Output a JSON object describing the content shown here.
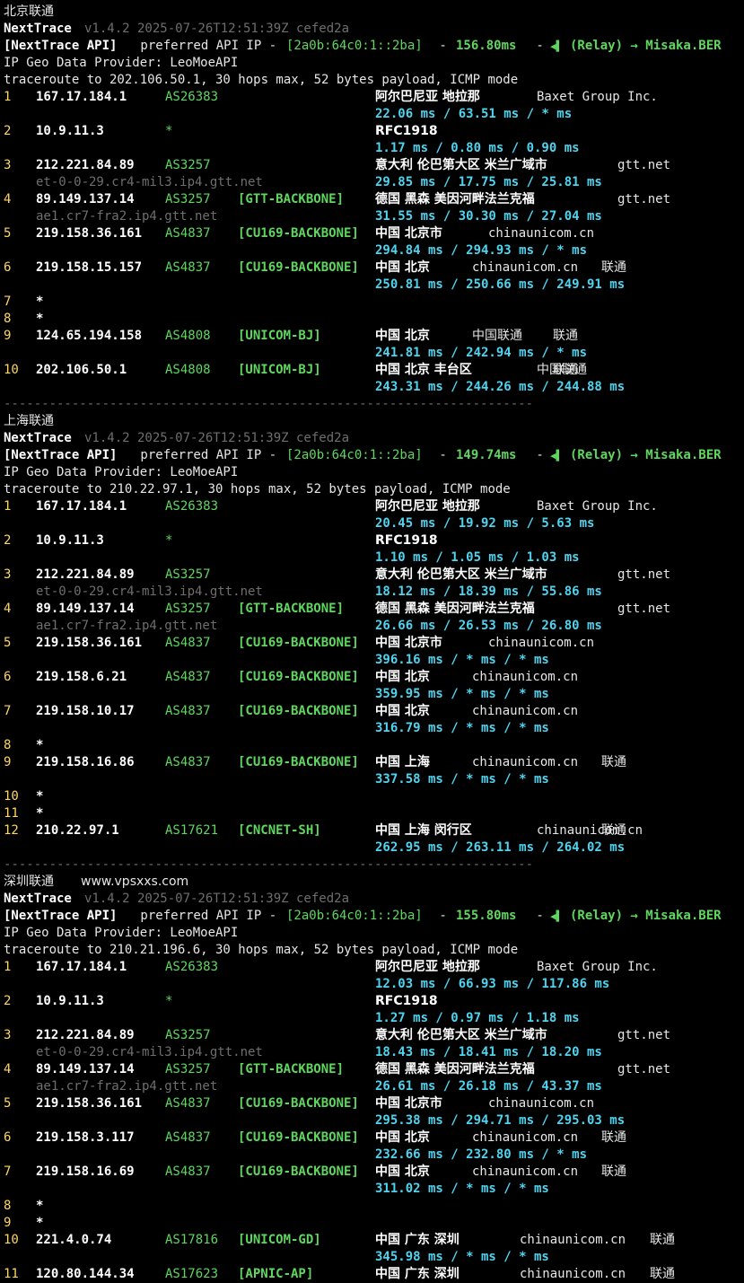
{
  "sections": [
    {
      "title": "北京联通",
      "version": "v1.4.2 2025-07-26T12:51:39Z cefed2a",
      "api_latency": "156.80ms",
      "target": "traceroute to 202.106.50.1, 30 hops max, 52 bytes payload, ICMP mode",
      "hops": [
        {
          "n": "1",
          "ip": "167.17.184.1",
          "asn": "AS26383",
          "tag": "",
          "geo": "阿尔巴尼亚 地拉那",
          "org": "Baxet Group Inc.",
          "isp": "",
          "host": "",
          "rtt": "22.06 ms / 63.51 ms / * ms"
        },
        {
          "n": "2",
          "ip": "10.9.11.3",
          "asn": "*",
          "tag": "",
          "geo": "RFC1918",
          "org": "",
          "isp": "",
          "host": "",
          "rtt": "1.17 ms / 0.80 ms / 0.90 ms"
        },
        {
          "n": "3",
          "ip": "212.221.84.89",
          "asn": "AS3257",
          "tag": "",
          "geo": "意大利 伦巴第大区 米兰广域市",
          "org": "gtt.net",
          "isp": "",
          "host": "et-0-0-29.cr4-mil3.ip4.gtt.net",
          "rtt": "29.85 ms / 17.75 ms / 25.81 ms"
        },
        {
          "n": "4",
          "ip": "89.149.137.14",
          "asn": "AS3257",
          "tag": "[GTT-BACKBONE]",
          "geo": "德国 黑森 美因河畔法兰克福",
          "org": "gtt.net",
          "isp": "",
          "host": "ae1.cr7-fra2.ip4.gtt.net",
          "rtt": "31.55 ms / 30.30 ms / 27.04 ms"
        },
        {
          "n": "5",
          "ip": "219.158.36.161",
          "asn": "AS4837",
          "tag": "[CU169-BACKBONE]",
          "geo": "中国 北京市",
          "org": "chinaunicom.cn",
          "isp": "",
          "host": "",
          "rtt": "294.84 ms / 294.93 ms / * ms"
        },
        {
          "n": "6",
          "ip": "219.158.15.157",
          "asn": "AS4837",
          "tag": "[CU169-BACKBONE]",
          "geo": "中国 北京",
          "org": "chinaunicom.cn",
          "isp": "联通",
          "host": "",
          "rtt": "250.81 ms / 250.66 ms / 249.91 ms"
        },
        {
          "n": "7",
          "ip": "*",
          "asn": "",
          "tag": "",
          "geo": "",
          "org": "",
          "isp": "",
          "host": "",
          "rtt": ""
        },
        {
          "n": "8",
          "ip": "*",
          "asn": "",
          "tag": "",
          "geo": "",
          "org": "",
          "isp": "",
          "host": "",
          "rtt": ""
        },
        {
          "n": "9",
          "ip": "124.65.194.158",
          "asn": "AS4808",
          "tag": "[UNICOM-BJ]",
          "geo": "中国 北京",
          "org": "中国联通",
          "isp": "联通",
          "host": "",
          "rtt": "241.81 ms / 242.94 ms / * ms"
        },
        {
          "n": "10",
          "ip": "202.106.50.1",
          "asn": "AS4808",
          "tag": "[UNICOM-BJ]",
          "geo": "中国 北京 丰台区",
          "org": "中国联通",
          "isp": "联通",
          "host": "",
          "rtt": "243.31 ms / 244.26 ms / 244.88 ms"
        }
      ]
    },
    {
      "title": "上海联通",
      "version": "v1.4.2 2025-07-26T12:51:39Z cefed2a",
      "api_latency": "149.74ms",
      "target": "traceroute to 210.22.97.1, 30 hops max, 52 bytes payload, ICMP mode",
      "hops": [
        {
          "n": "1",
          "ip": "167.17.184.1",
          "asn": "AS26383",
          "tag": "",
          "geo": "阿尔巴尼亚 地拉那",
          "org": "Baxet Group Inc.",
          "isp": "",
          "host": "",
          "rtt": "20.45 ms / 19.92 ms / 5.63 ms"
        },
        {
          "n": "2",
          "ip": "10.9.11.3",
          "asn": "*",
          "tag": "",
          "geo": "RFC1918",
          "org": "",
          "isp": "",
          "host": "",
          "rtt": "1.10 ms / 1.05 ms / 1.03 ms"
        },
        {
          "n": "3",
          "ip": "212.221.84.89",
          "asn": "AS3257",
          "tag": "",
          "geo": "意大利 伦巴第大区 米兰广域市",
          "org": "gtt.net",
          "isp": "",
          "host": "et-0-0-29.cr4-mil3.ip4.gtt.net",
          "rtt": "18.12 ms / 18.39 ms / 55.86 ms"
        },
        {
          "n": "4",
          "ip": "89.149.137.14",
          "asn": "AS3257",
          "tag": "[GTT-BACKBONE]",
          "geo": "德国 黑森 美因河畔法兰克福",
          "org": "gtt.net",
          "isp": "",
          "host": "ae1.cr7-fra2.ip4.gtt.net",
          "rtt": "26.66 ms / 26.53 ms / 26.80 ms"
        },
        {
          "n": "5",
          "ip": "219.158.36.161",
          "asn": "AS4837",
          "tag": "[CU169-BACKBONE]",
          "geo": "中国 北京市",
          "org": "chinaunicom.cn",
          "isp": "",
          "host": "",
          "rtt": "396.16 ms / * ms / * ms"
        },
        {
          "n": "6",
          "ip": "219.158.6.21",
          "asn": "AS4837",
          "tag": "[CU169-BACKBONE]",
          "geo": "中国 北京",
          "org": "chinaunicom.cn",
          "isp": "",
          "host": "",
          "rtt": "359.95 ms / * ms / * ms"
        },
        {
          "n": "7",
          "ip": "219.158.10.17",
          "asn": "AS4837",
          "tag": "[CU169-BACKBONE]",
          "geo": "中国 北京",
          "org": "chinaunicom.cn",
          "isp": "",
          "host": "",
          "rtt": "316.79 ms / * ms / * ms"
        },
        {
          "n": "8",
          "ip": "*",
          "asn": "",
          "tag": "",
          "geo": "",
          "org": "",
          "isp": "",
          "host": "",
          "rtt": ""
        },
        {
          "n": "9",
          "ip": "219.158.16.86",
          "asn": "AS4837",
          "tag": "[CU169-BACKBONE]",
          "geo": "中国 上海",
          "org": "chinaunicom.cn",
          "isp": "联通",
          "host": "",
          "rtt": "337.58 ms / * ms / * ms"
        },
        {
          "n": "10",
          "ip": "*",
          "asn": "",
          "tag": "",
          "geo": "",
          "org": "",
          "isp": "",
          "host": "",
          "rtt": ""
        },
        {
          "n": "11",
          "ip": "*",
          "asn": "",
          "tag": "",
          "geo": "",
          "org": "",
          "isp": "",
          "host": "",
          "rtt": ""
        },
        {
          "n": "12",
          "ip": "210.22.97.1",
          "asn": "AS17621",
          "tag": "[CNCNET-SH]",
          "geo": "中国 上海 闵行区",
          "org": "chinaunicom.cn",
          "isp": "联通",
          "host": "",
          "rtt": "262.95 ms / 263.11 ms / 264.02 ms"
        }
      ]
    },
    {
      "title": "深圳联通",
      "watermark": "www.vpsxxs.com",
      "version": "v1.4.2 2025-07-26T12:51:39Z cefed2a",
      "api_latency": "155.80ms",
      "target": "traceroute to 210.21.196.6, 30 hops max, 52 bytes payload, ICMP mode",
      "hops": [
        {
          "n": "1",
          "ip": "167.17.184.1",
          "asn": "AS26383",
          "tag": "",
          "geo": "阿尔巴尼亚 地拉那",
          "org": "Baxet Group Inc.",
          "isp": "",
          "host": "",
          "rtt": "12.03 ms / 66.93 ms / 117.86 ms"
        },
        {
          "n": "2",
          "ip": "10.9.11.3",
          "asn": "*",
          "tag": "",
          "geo": "RFC1918",
          "org": "",
          "isp": "",
          "host": "",
          "rtt": "1.27 ms / 0.97 ms / 1.18 ms"
        },
        {
          "n": "3",
          "ip": "212.221.84.89",
          "asn": "AS3257",
          "tag": "",
          "geo": "意大利 伦巴第大区 米兰广域市",
          "org": "gtt.net",
          "isp": "",
          "host": "et-0-0-29.cr4-mil3.ip4.gtt.net",
          "rtt": "18.43 ms / 18.41 ms / 18.20 ms"
        },
        {
          "n": "4",
          "ip": "89.149.137.14",
          "asn": "AS3257",
          "tag": "[GTT-BACKBONE]",
          "geo": "德国 黑森 美因河畔法兰克福",
          "org": "gtt.net",
          "isp": "",
          "host": "ae1.cr7-fra2.ip4.gtt.net",
          "rtt": "26.61 ms / 26.18 ms / 43.37 ms"
        },
        {
          "n": "5",
          "ip": "219.158.36.161",
          "asn": "AS4837",
          "tag": "[CU169-BACKBONE]",
          "geo": "中国 北京市",
          "org": "chinaunicom.cn",
          "isp": "",
          "host": "",
          "rtt": "295.38 ms / 294.71 ms / 295.03 ms"
        },
        {
          "n": "6",
          "ip": "219.158.3.117",
          "asn": "AS4837",
          "tag": "[CU169-BACKBONE]",
          "geo": "中国 北京",
          "org": "chinaunicom.cn",
          "isp": "联通",
          "host": "",
          "rtt": "232.66 ms / 232.80 ms / * ms"
        },
        {
          "n": "7",
          "ip": "219.158.16.69",
          "asn": "AS4837",
          "tag": "[CU169-BACKBONE]",
          "geo": "中国 北京",
          "org": "chinaunicom.cn",
          "isp": "联通",
          "host": "",
          "rtt": "311.02 ms / * ms / * ms"
        },
        {
          "n": "8",
          "ip": "*",
          "asn": "",
          "tag": "",
          "geo": "",
          "org": "",
          "isp": "",
          "host": "",
          "rtt": ""
        },
        {
          "n": "9",
          "ip": "*",
          "asn": "",
          "tag": "",
          "geo": "",
          "org": "",
          "isp": "",
          "host": "",
          "rtt": ""
        },
        {
          "n": "10",
          "ip": "221.4.0.74",
          "asn": "AS17816",
          "tag": "[UNICOM-GD]",
          "geo": "中国 广东 深圳",
          "org": "chinaunicom.cn",
          "isp": "联通",
          "host": "",
          "rtt": "345.98 ms / * ms / * ms"
        },
        {
          "n": "11",
          "ip": "120.80.144.34",
          "asn": "AS17623",
          "tag": "[APNIC-AP]",
          "geo": "中国 广东 深圳",
          "org": "chinaunicom.cn",
          "isp": "联通",
          "host": "",
          "rtt": ""
        }
      ]
    }
  ],
  "common": {
    "app_name": "NextTrace",
    "api_prefix": "[NextTrace API]",
    "api_text": " preferred API IP - ",
    "api_ip": "[2a0b:64c0:1::2ba]",
    "api_dash": " - ",
    "relay": "(Relay) → Misaka.BER",
    "geo_provider": "IP Geo Data Provider: LeoMoeAPI",
    "separator": "----------------------------------------------------------------------"
  },
  "colors": {
    "background": "#000000",
    "green": "#5fd75f",
    "cyan": "#4fd4f0",
    "dim": "#6e6e6e",
    "yellow": "#ffd75f"
  }
}
